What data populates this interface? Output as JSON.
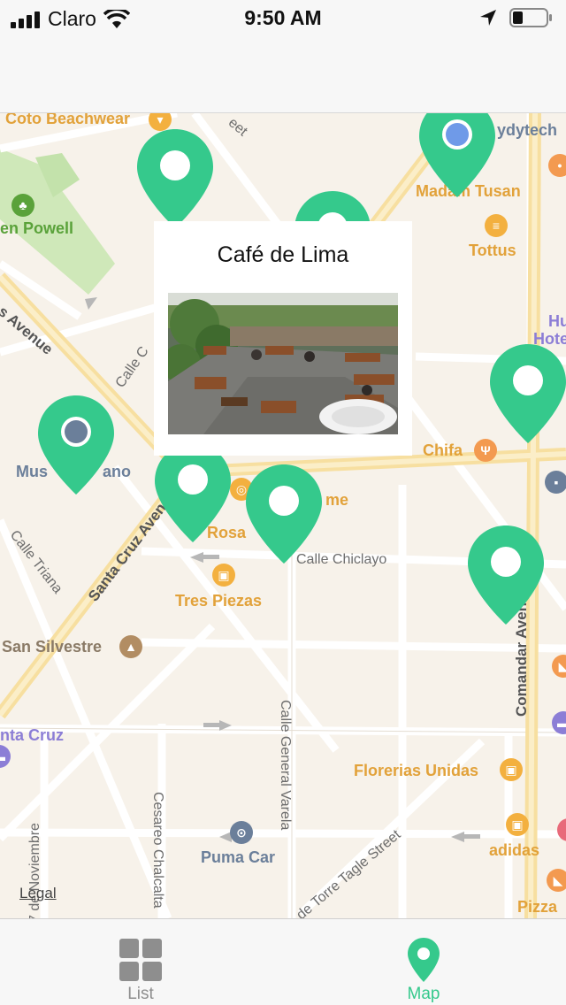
{
  "status_bar": {
    "carrier": "Claro",
    "time": "9:50 AM"
  },
  "map": {
    "pin_color": "#35c98c",
    "pois": {
      "coto_beachwear": "Coto Beachwear",
      "ydytech": "ydytech",
      "madam_tusan": "Madam Tusan",
      "tottus": "Tottus",
      "en_powell": "en Powell",
      "hu": "Hu",
      "hote": "Hote",
      "museo": "Mus",
      "museo_end": "ano",
      "chifa": "Chifa",
      "rosa": "Rosa",
      "chili": "hili",
      "chili_end": "me",
      "tres_piezas": "Tres Piezas",
      "san_silvestre": "San Silvestre",
      "santa_cruz_poi": "nta Cruz",
      "florerias_unidas": "Florerias Unidas",
      "puma_car": "Puma Car",
      "adidas": "adidas",
      "pizza": "Pizza"
    },
    "streets": {
      "avenue_left": "s Avenue",
      "calle_c": "Calle C",
      "calle_triana": "Calle Triana",
      "santa_cruz_avenue": "Santa Cruz Avenue",
      "calle_chiclayo": "Calle Chiclayo",
      "comandante_avenue": "Comandar Avenue",
      "calle_general_varela": "Calle General Varela",
      "cesareo_chalcalta": "Cesareo Chalcalta",
      "noviembre": "7 de Noviembre",
      "torre_tagle": "de Torre Tagle Street",
      "eet": "eet"
    },
    "legal": "Legal"
  },
  "callout": {
    "title": "Café de Lima"
  },
  "tabs": [
    {
      "label": "List",
      "icon": "grid-icon",
      "selected": false
    },
    {
      "label": "Map",
      "icon": "map-pin-icon",
      "selected": true
    }
  ],
  "colors": {
    "accent": "#35c98c",
    "inactive": "#8e8e8e"
  }
}
